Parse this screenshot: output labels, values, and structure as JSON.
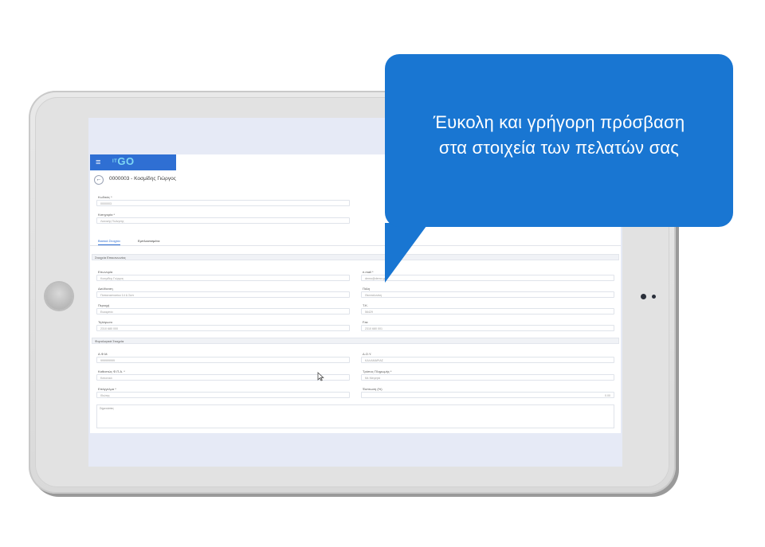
{
  "callout": {
    "line1": "Έυκολη και γρήγορη πρόσβαση",
    "line2": "στα στοιχεία των πελατών σας"
  },
  "app": {
    "menu_icon": "≡",
    "logo_prefix": "IT",
    "logo": "GO",
    "back_icon": "←",
    "record_title": "0000003 - Κοσμίδης Γιώργος",
    "code_label": "Κωδικός *",
    "code_value": "0000003",
    "category_label": "Κατηγορία *",
    "category_value": "Λιανικής Πώλησης",
    "tabs": [
      "Βασικά Στοιχεία",
      "Εμπλουτισμένα"
    ],
    "sections": {
      "contact": "Στοιχεία Επικοινωνίας",
      "tax": "Φορολογικά Στοιχεία"
    },
    "fields": {
      "name_label": "Επωνυμία",
      "name_value": "Κοσμίδης Γιώργος",
      "email_label": "e-mail *",
      "email_value": "demo@demo.gr",
      "address_label": "Διεύθυνση",
      "address_value": "Παπαναστασίου 14 & Σαπ",
      "city_label": "Πόλη",
      "city_value": "Θεσσαλονίκη",
      "area_label": "Περιοχή",
      "area_value": "Ευκαρπία",
      "zip_label": "Τ.Κ.",
      "zip_value": "56429",
      "phone_label": "Τηλέφωνο",
      "phone_value": "2310 680 000",
      "fax_label": "Fax",
      "fax_value": "2310 680 001",
      "afm_label": "Α.Φ.Μ.",
      "afm_value": "999999999",
      "doy_label": "Δ.Ο.Υ.",
      "doy_value": "ΚΑΛΑΜΑΡΙΑΣ",
      "vat_label": "Καθεστώς Φ.Π.Α. *",
      "vat_value": "Κανονικό",
      "payment_label": "Τρόπος Πληρωμής *",
      "payment_value": "Με Μετρητά",
      "profession_label": "Επάγγελμα *",
      "profession_value": "Ιδιώτης",
      "discount_label": "Έκπτωση (%)",
      "discount_value": "0.00",
      "notes_label": "Σημειώσεις"
    }
  },
  "colors": {
    "callout_blue": "#1976d2",
    "app_topbar": "#2f6fd3",
    "logo_cyan": "#7fd8f4"
  }
}
